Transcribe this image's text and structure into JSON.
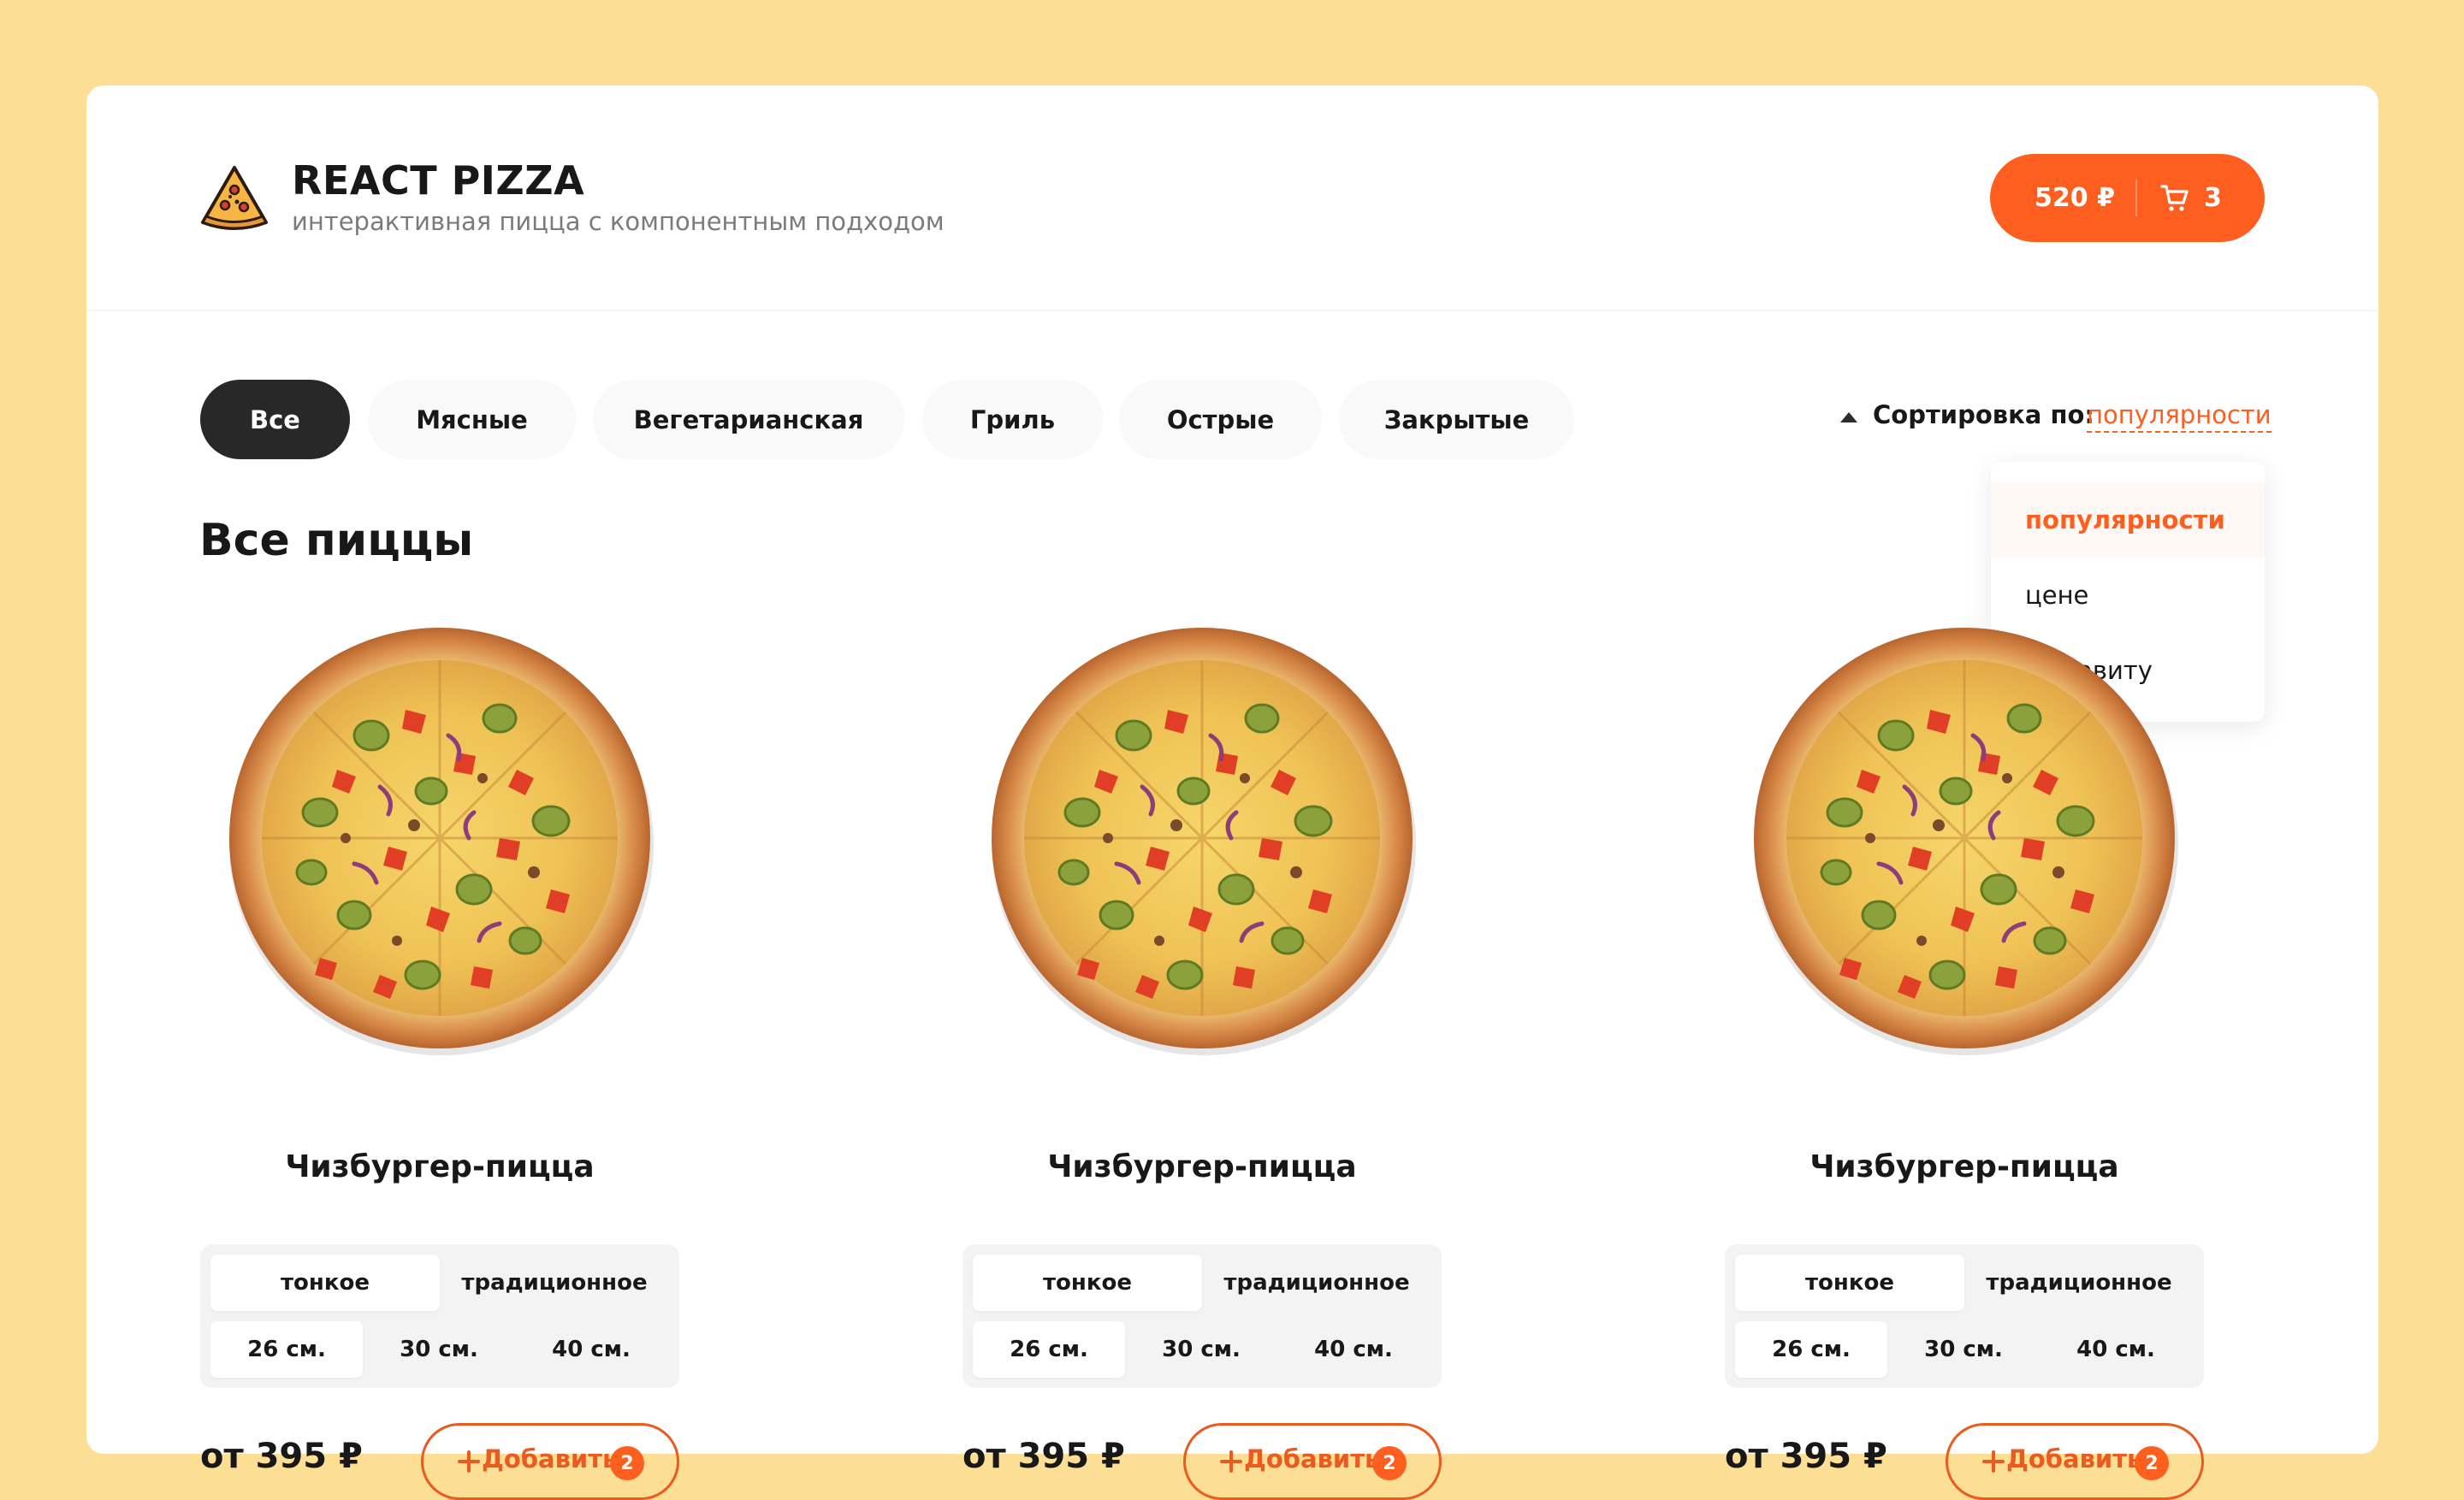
{
  "header": {
    "title": "REACT PIZZA",
    "subtitle": "интерактивная пицца с компонентным подходом",
    "logo_icon": "pizza-slice-icon",
    "cart": {
      "price": "520 ₽",
      "count": "3",
      "icon": "shopping-cart-icon"
    }
  },
  "categories": {
    "items": [
      "Все",
      "Мясные",
      "Вегетарианская",
      "Гриль",
      "Острые",
      "Закрытые"
    ],
    "active_index": 0
  },
  "sort": {
    "label": "Сортировка по:",
    "value": "популярности",
    "options": [
      "популярности",
      "цене",
      "алфавиту"
    ],
    "active_index": 0
  },
  "section_title": "Все пиццы",
  "pizzas": [
    {
      "name": "Чизбургер-пицца",
      "types": [
        "тонкое",
        "традиционное"
      ],
      "sizes": [
        "26 см.",
        "30 см.",
        "40 см."
      ],
      "price": "от 395 ₽",
      "add_label": "Добавить",
      "add_count": "2"
    },
    {
      "name": "Чизбургер-пицца",
      "types": [
        "тонкое",
        "традиционное"
      ],
      "sizes": [
        "26 см.",
        "30 см.",
        "40 см."
      ],
      "price": "от 395 ₽",
      "add_label": "Добавить",
      "add_count": "2"
    },
    {
      "name": "Чизбургер-пицца",
      "types": [
        "тонкое",
        "традиционное"
      ],
      "sizes": [
        "26 см.",
        "30 см.",
        "40 см."
      ],
      "price": "от 395 ₽",
      "add_label": "Добавить",
      "add_count": "2"
    }
  ],
  "colors": {
    "accent": "#FE5F1E",
    "background": "#FCDE95",
    "dark": "#282828"
  }
}
